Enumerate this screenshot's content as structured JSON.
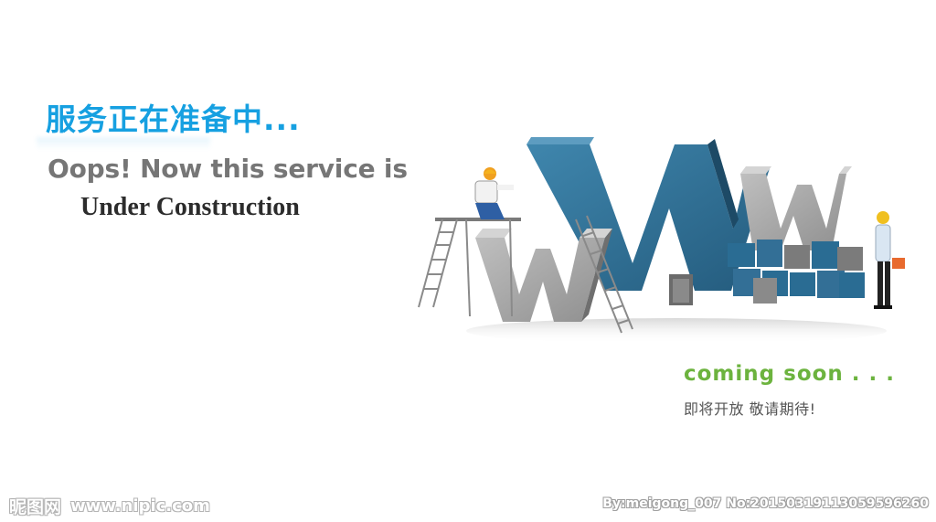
{
  "heading": {
    "title_cn": "服务正在准备中...",
    "oops_line": "Oops! Now this service is",
    "construction_line": "Under Construction"
  },
  "illustration": {
    "letters": [
      "W",
      "W",
      "W"
    ],
    "icons": [
      "worker-on-scaffold-icon",
      "engineer-with-toolbox-icon",
      "ladder-icon",
      "blocks-icon"
    ]
  },
  "coming_soon": {
    "text": "coming soon . . .",
    "text_cn": "即将开放 敬请期待!"
  },
  "watermark": {
    "logo": "昵图网",
    "site": "www.nipic.com",
    "credit": "By:meigong_007 No:20150319113059596260"
  },
  "colors": {
    "title_blue": "#16a0e1",
    "gray_text": "#767676",
    "dark_text": "#2c2c2c",
    "steel_blue": "#2d6f96",
    "coming_green": "#6cb33e"
  }
}
